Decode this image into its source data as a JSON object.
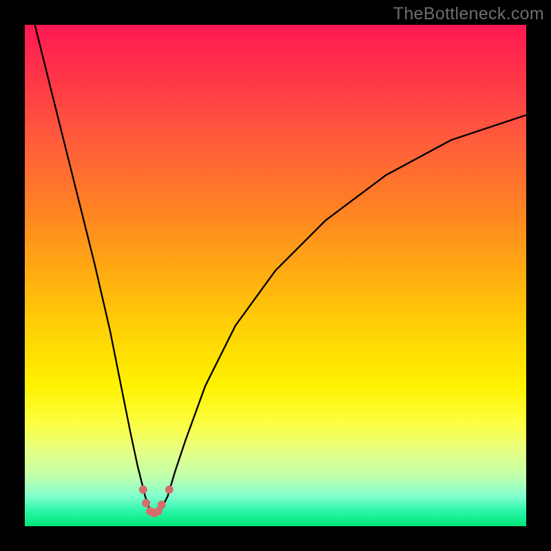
{
  "watermark": "TheBottleneck.com",
  "gradient_colors": {
    "top": "#ff1852",
    "mid_upper": "#ff8024",
    "mid": "#ffcf06",
    "mid_lower": "#fff200",
    "low": "#c2ffab",
    "bottom": "#00e679"
  },
  "chart_data": {
    "type": "line",
    "title": "",
    "xlabel": "",
    "ylabel": "",
    "xlim": [
      0,
      100
    ],
    "ylim": [
      0,
      100
    ],
    "series": [
      {
        "name": "bottleneck-curve",
        "x": [
          2,
          5,
          8,
          11,
          14,
          17,
          19,
          21,
          22.5,
          24,
          25,
          25.8,
          27,
          28.5,
          30,
          32,
          36,
          42,
          50,
          60,
          72,
          85,
          100
        ],
        "values": [
          100,
          88,
          76,
          64,
          52,
          39,
          29,
          19,
          12,
          6,
          3,
          2,
          3,
          6,
          11,
          17,
          28,
          40,
          51,
          61,
          70,
          77,
          82
        ]
      }
    ],
    "markers": {
      "name": "highlight-points",
      "points": [
        {
          "x": 23.6,
          "y": 7.3
        },
        {
          "x": 24.2,
          "y": 4.6
        },
        {
          "x": 25.0,
          "y": 3.0
        },
        {
          "x": 25.8,
          "y": 2.6
        },
        {
          "x": 26.6,
          "y": 3.0
        },
        {
          "x": 27.3,
          "y": 4.3
        },
        {
          "x": 28.8,
          "y": 7.3
        }
      ],
      "color": "#d86b6b",
      "radius": 6
    }
  }
}
